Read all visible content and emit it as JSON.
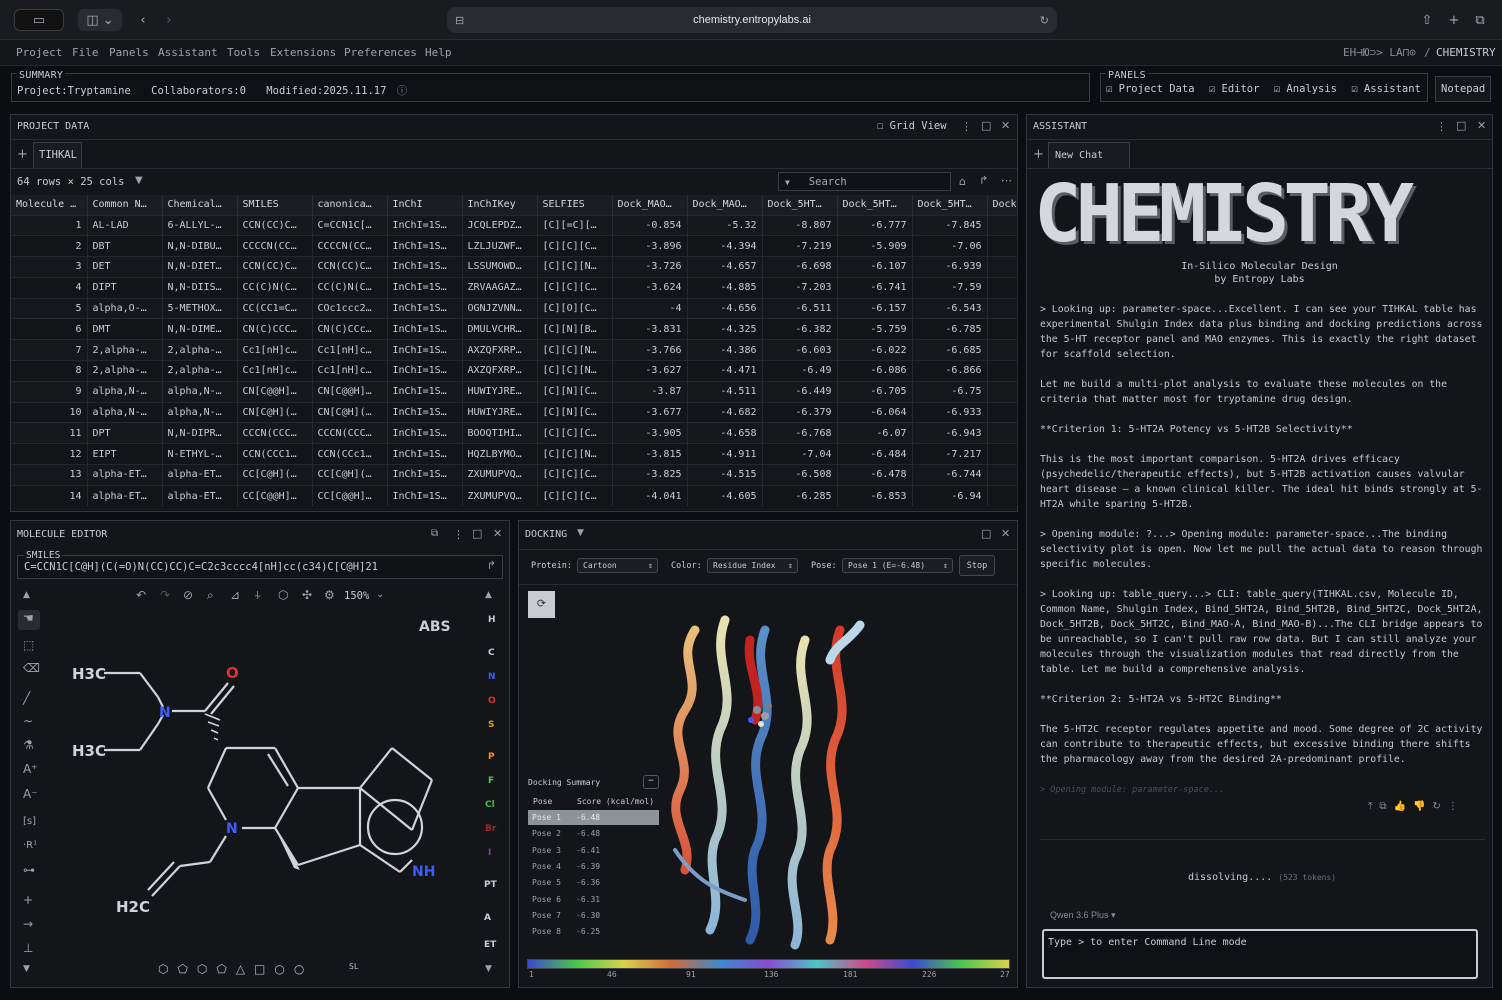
{
  "browser": {
    "url": "chemistry.entropylabs.ai"
  },
  "menu": {
    "items": [
      "Project",
      "File",
      "Panels",
      "Assistant",
      "Tools",
      "Extensions",
      "Preferences",
      "Help"
    ],
    "brand": "ΕΗ⊣Ю⊃> LA⊓⊙",
    "brand_sep": "/",
    "section": "CHEMISTRY"
  },
  "summary": {
    "heading": "SUMMARY",
    "project_label": "Project:",
    "project": "Tryptamine",
    "collab_label": "Collaborators:",
    "collab": "0",
    "modified_label": "Modified:",
    "modified": "2025.11.17"
  },
  "panels": {
    "heading": "PANELS",
    "items": [
      "Project Data",
      "Editor",
      "Analysis",
      "Assistant"
    ],
    "notepad": "Notepad"
  },
  "project_data": {
    "title": "PROJECT DATA",
    "grid_view": "Grid View",
    "tab": "TIHKAL",
    "rows_info": "64 rows × 25 cols",
    "search_placeholder": "Search",
    "columns": [
      "Molecule …",
      "Common N…",
      "Chemical…",
      "SMILES",
      "canonica…",
      "InChI",
      "InChIKey",
      "SELFIES",
      "Dock_MAO…",
      "Dock_MAO…",
      "Dock_5HT…",
      "Dock_5HT…",
      "Dock_5HT…",
      "Dock"
    ],
    "rows": [
      [
        "1",
        "AL-LAD",
        "6-ALLYL-…",
        "CCN(CC)C…",
        "C=CCN1C[…",
        "InChI=1S…",
        "JCQLEPDZ…",
        "[C][=C][…",
        "-0.854",
        "-5.32",
        "-8.807",
        "-6.777",
        "-7.845"
      ],
      [
        "2",
        "DBT",
        "N,N-DIBU…",
        "CCCCN(CC…",
        "CCCCN(CC…",
        "InChI=1S…",
        "LZLJUZWF…",
        "[C][C][C…",
        "-3.896",
        "-4.394",
        "-7.219",
        "-5.909",
        "-7.06"
      ],
      [
        "3",
        "DET",
        "N,N-DIET…",
        "CCN(CC)C…",
        "CCN(CC)C…",
        "InChI=1S…",
        "LSSUMOWD…",
        "[C][C][N…",
        "-3.726",
        "-4.657",
        "-6.698",
        "-6.107",
        "-6.939"
      ],
      [
        "4",
        "DIPT",
        "N,N-DIIS…",
        "CC(C)N(C…",
        "CC(C)N(C…",
        "InChI=1S…",
        "ZRVAAGAZ…",
        "[C][C][C…",
        "-3.624",
        "-4.885",
        "-7.203",
        "-6.741",
        "-7.59"
      ],
      [
        "5",
        "alpha,O-…",
        "5-METHOX…",
        "CC(CC1=C…",
        "COc1ccc2…",
        "InChI=1S…",
        "OGNJZVNN…",
        "[C][O][C…",
        "-4",
        "-4.656",
        "-6.511",
        "-6.157",
        "-6.543"
      ],
      [
        "6",
        "DMT",
        "N,N-DIME…",
        "CN(C)CCC…",
        "CN(C)CCc…",
        "InChI=1S…",
        "DMULVCHR…",
        "[C][N][B…",
        "-3.831",
        "-4.325",
        "-6.382",
        "-5.759",
        "-6.785"
      ],
      [
        "7",
        "2,alpha-…",
        "2,alpha-…",
        "Cc1[nH]c…",
        "Cc1[nH]c…",
        "InChI=1S…",
        "AXZQFXRP…",
        "[C][C][N…",
        "-3.766",
        "-4.386",
        "-6.603",
        "-6.022",
        "-6.685"
      ],
      [
        "8",
        "2,alpha-…",
        "2,alpha-…",
        "Cc1[nH]c…",
        "Cc1[nH]c…",
        "InChI=1S…",
        "AXZQFXRP…",
        "[C][C][N…",
        "-3.627",
        "-4.471",
        "-6.49",
        "-6.086",
        "-6.866"
      ],
      [
        "9",
        "alpha,N-…",
        "alpha,N-…",
        "CN[C@@H]…",
        "CN[C@@H]…",
        "InChI=1S…",
        "HUWIYJRE…",
        "[C][N][C…",
        "-3.87",
        "-4.511",
        "-6.449",
        "-6.705",
        "-6.75"
      ],
      [
        "10",
        "alpha,N-…",
        "alpha,N-…",
        "CN[C@H](…",
        "CN[C@H](…",
        "InChI=1S…",
        "HUWIYJRE…",
        "[C][N][C…",
        "-3.677",
        "-4.682",
        "-6.379",
        "-6.064",
        "-6.933"
      ],
      [
        "11",
        "DPT",
        "N,N-DIPR…",
        "CCCN(CCC…",
        "CCCN(CCC…",
        "InChI=1S…",
        "BOOQTIHI…",
        "[C][C][C…",
        "-3.905",
        "-4.658",
        "-6.768",
        "-6.07",
        "-6.943"
      ],
      [
        "12",
        "EIPT",
        "N-ETHYL-…",
        "CCN(CCC1…",
        "CCN(CCc1…",
        "InChI=1S…",
        "HQZLBYMO…",
        "[C][C][N…",
        "-3.815",
        "-4.911",
        "-7.04",
        "-6.484",
        "-7.217"
      ],
      [
        "13",
        "alpha-ET…",
        "alpha-ET…",
        "CC[C@H](…",
        "CC[C@H](…",
        "InChI=1S…",
        "ZXUMUPVQ…",
        "[C][C][C…",
        "-3.825",
        "-4.515",
        "-6.508",
        "-6.478",
        "-6.744"
      ],
      [
        "14",
        "alpha-ET…",
        "alpha-ET…",
        "CC[C@@H]…",
        "CC[C@@H]…",
        "InChI=1S…",
        "ZXUMUPVQ…",
        "[C][C][C…",
        "-4.041",
        "-4.605",
        "-6.285",
        "-6.853",
        "-6.94"
      ]
    ]
  },
  "editor": {
    "title": "MOLECULE EDITOR",
    "smiles_label": "SMILES",
    "smiles": "C=CCN1C[C@H](C(=O)N(CC)CC)C=C2c3cccc4[nH]cc(c34)C[C@H]21",
    "zoom": "150%",
    "abs": "ABS",
    "elements": [
      {
        "s": "H",
        "c": "#c9ccd3"
      },
      {
        "s": "C",
        "c": "#c9ccd3"
      },
      {
        "s": "N",
        "c": "#3d5cff"
      },
      {
        "s": "O",
        "c": "#e0302f"
      },
      {
        "s": "S",
        "c": "#d4a017"
      },
      {
        "s": "P",
        "c": "#ff8c1a"
      },
      {
        "s": "F",
        "c": "#4ec94e"
      },
      {
        "s": "Cl",
        "c": "#3ac43a"
      },
      {
        "s": "Br",
        "c": "#9a2a2a"
      },
      {
        "s": "I",
        "c": "#8b3aa8"
      },
      {
        "s": "PT",
        "c": "#c9ccd3"
      },
      {
        "s": "A",
        "c": "#c9ccd3"
      },
      {
        "s": "ET",
        "c": "#c9ccd3"
      }
    ],
    "atoms": {
      "h3c_top": "H3C",
      "h3c_bot": "H3C",
      "o": "O",
      "n1": "N",
      "n2": "N",
      "nh": "NH",
      "h2c": "H2C"
    }
  },
  "docking": {
    "title": "DOCKING",
    "protein_label": "Protein:",
    "protein": "Cartoon",
    "color_label": "Color:",
    "color": "Residue Index",
    "pose_label": "Pose:",
    "pose": "Pose 1 (E=-6.48)",
    "stop": "Stop",
    "summary_title": "Docking Summary",
    "col_pose": "Pose",
    "col_score": "Score (kcal/mol)",
    "poses": [
      {
        "pose": "Pose 1",
        "score": "-6.48"
      },
      {
        "pose": "Pose 2",
        "score": "-6.48"
      },
      {
        "pose": "Pose 3",
        "score": "-6.41"
      },
      {
        "pose": "Pose 4",
        "score": "-6.39"
      },
      {
        "pose": "Pose 5",
        "score": "-6.36"
      },
      {
        "pose": "Pose 6",
        "score": "-6.31"
      },
      {
        "pose": "Pose 7",
        "score": "-6.30"
      },
      {
        "pose": "Pose 8",
        "score": "-6.25"
      }
    ],
    "seq_ticks": [
      "1",
      "46",
      "91",
      "136",
      "181",
      "226",
      "27"
    ]
  },
  "assistant": {
    "title": "ASSISTANT",
    "tab": "New Chat",
    "logo_text": "CHEMISTRY",
    "subtitle1": "In-Silico Molecular Design",
    "subtitle2": "by Entropy Labs",
    "messages": [
      "> Looking up: parameter-space...Excellent. I can see your TIHKAL table has",
      "experimental Shulgin Index data plus binding and docking predictions across",
      "the 5-HT receptor panel and MAO enzymes. This is exactly the right dataset",
      "for scaffold selection.",
      "",
      "Let me build a multi-plot analysis to evaluate these molecules on the",
      "criteria that matter most for tryptamine drug design.",
      "",
      "**Criterion 1: 5-HT2A Potency vs 5-HT2B Selectivity**",
      "",
      "This is the most important comparison. 5-HT2A drives efficacy",
      "(psychedelic/therapeutic effects), but 5-HT2B activation causes valvular",
      "heart disease — a known clinical killer. The ideal hit binds strongly at 5-",
      "HT2A while sparing 5-HT2B.",
      "",
      "> Opening module: ?...> Opening module: parameter-space...The binding",
      "selectivity plot is open. Now let me pull the actual data to reason through",
      "specific molecules.",
      "",
      "> Looking up: table_query...> CLI: table_query(TIHKAL.csv, Molecule ID,",
      "Common Name, Shulgin Index, Bind_5HT2A, Bind_5HT2B, Bind_5HT2C, Dock_5HT2A,",
      "Dock_5HT2B, Dock_5HT2C, Bind_MAO-A, Bind_MAO-B)...The CLI bridge appears to",
      "be unreachable, so I can't pull raw row data. But I can still analyze your",
      "molecules through the visualization modules that read directly from the",
      "table. Let me build a comprehensive analysis.",
      "",
      "**Criterion 2: 5-HT2A vs 5-HT2C Binding**",
      "",
      "The 5-HT2C receptor regulates appetite and mood. Some degree of 2C activity",
      "can contribute to therapeutic effects, but excessive binding there shifts",
      "the pharmacology away from the desired 2A-predominant profile."
    ],
    "faded": "> Opening module: parameter-space...",
    "status": "dissolving....",
    "tokens": "(523 tokens)",
    "model": "Qwen 3.6 Plus",
    "input_placeholder": "Type > to enter Command Line mode"
  }
}
